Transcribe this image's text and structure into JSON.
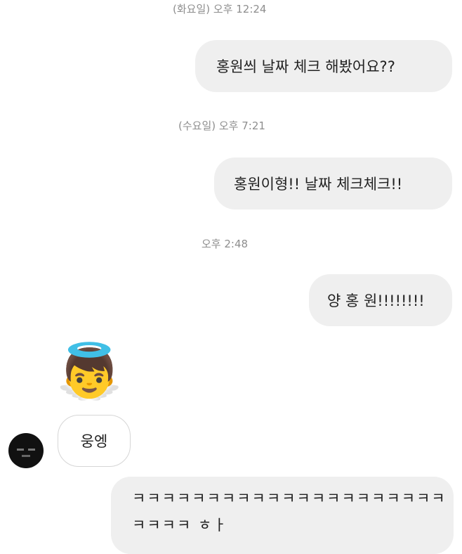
{
  "thread": {
    "ts1": "(화요일) 오후 12:24",
    "msg1": "홍원씌 날짜 체크 해봤어요??",
    "ts2": "(수요일) 오후 7:21",
    "msg2": "홍원이형!! 날짜 체크체크!!",
    "ts3": "오후 2:48",
    "msg3": "양 홍 원!!!!!!!!",
    "reply_emoji": "👼",
    "reply_text": "웅엥",
    "msg4_line1": "ㅋㅋㅋㅋㅋㅋㅋㅋㅋㅋㅋㅋㅋㅋㅋㅋㅋㅋㅋㅋㅋ",
    "msg4_line2": "ㅋㅋㅋㅋ ㅎㅏ"
  }
}
